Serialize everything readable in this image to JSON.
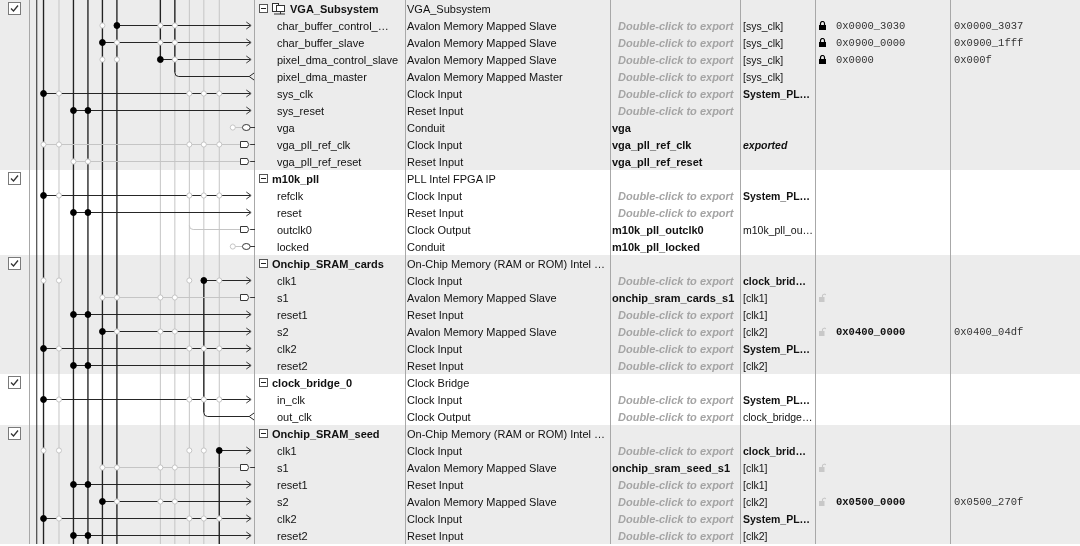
{
  "modules": [
    {
      "checked": true,
      "expanded": true,
      "kind": "subsystem",
      "name": "VGA_Subsystem",
      "description": "VGA_Subsystem",
      "ports": [
        {
          "name": "char_buffer_control_…",
          "description": "Avalon Memory Mapped Slave",
          "export": {
            "text": "Double-click to export",
            "kind": "hint"
          },
          "clock": {
            "text": "[sys_clk]",
            "kind": "domain"
          },
          "locked": true,
          "base": "0x0000_3030",
          "end": "0x0000_3037"
        },
        {
          "name": "char_buffer_slave",
          "description": "Avalon Memory Mapped Slave",
          "export": {
            "text": "Double-click to export",
            "kind": "hint"
          },
          "clock": {
            "text": "[sys_clk]",
            "kind": "domain"
          },
          "locked": true,
          "base": "0x0900_0000",
          "end": "0x0900_1fff"
        },
        {
          "name": "pixel_dma_control_slave",
          "description": "Avalon Memory Mapped Slave",
          "export": {
            "text": "Double-click to export",
            "kind": "hint"
          },
          "clock": {
            "text": "[sys_clk]",
            "kind": "domain"
          },
          "locked": true,
          "base": "0x0000",
          "end": "0x000f"
        },
        {
          "name": "pixel_dma_master",
          "description": "Avalon Memory Mapped Master",
          "export": {
            "text": "Double-click to export",
            "kind": "hint"
          },
          "clock": {
            "text": "[sys_clk]",
            "kind": "domain"
          }
        },
        {
          "name": "sys_clk",
          "description": "Clock Input",
          "export": {
            "text": "Double-click to export",
            "kind": "hint"
          },
          "clock": {
            "text": "System_PL…",
            "kind": "source"
          }
        },
        {
          "name": "sys_reset",
          "description": "Reset Input",
          "export": {
            "text": "Double-click to export",
            "kind": "hint"
          }
        },
        {
          "name": "vga",
          "description": "Conduit",
          "export": {
            "text": "vga",
            "kind": "name"
          }
        },
        {
          "name": "vga_pll_ref_clk",
          "description": "Clock Input",
          "export": {
            "text": "vga_pll_ref_clk",
            "kind": "name"
          },
          "clock": {
            "text": "exported",
            "kind": "exported"
          }
        },
        {
          "name": "vga_pll_ref_reset",
          "description": "Reset Input",
          "export": {
            "text": "vga_pll_ref_reset",
            "kind": "name"
          }
        }
      ]
    },
    {
      "checked": true,
      "expanded": true,
      "kind": "component",
      "name": "m10k_pll",
      "description": "PLL Intel FPGA IP",
      "ports": [
        {
          "name": "refclk",
          "description": "Clock Input",
          "export": {
            "text": "Double-click to export",
            "kind": "hint"
          },
          "clock": {
            "text": "System_PL…",
            "kind": "source"
          }
        },
        {
          "name": "reset",
          "description": "Reset Input",
          "export": {
            "text": "Double-click to export",
            "kind": "hint"
          }
        },
        {
          "name": "outclk0",
          "description": "Clock Output",
          "export": {
            "text": "m10k_pll_outclk0",
            "kind": "name"
          },
          "clock": {
            "text": "m10k_pll_ou…",
            "kind": "domain"
          }
        },
        {
          "name": "locked",
          "description": "Conduit",
          "export": {
            "text": "m10k_pll_locked",
            "kind": "name"
          }
        }
      ]
    },
    {
      "checked": true,
      "expanded": true,
      "kind": "component",
      "name": "Onchip_SRAM_cards",
      "description": "On-Chip Memory (RAM or ROM) Intel …",
      "ports": [
        {
          "name": "clk1",
          "description": "Clock Input",
          "export": {
            "text": "Double-click to export",
            "kind": "hint"
          },
          "clock": {
            "text": "clock_brid…",
            "kind": "source"
          }
        },
        {
          "name": "s1",
          "description": "Avalon Memory Mapped Slave",
          "export": {
            "text": "onchip_sram_cards_s1",
            "kind": "name"
          },
          "clock": {
            "text": "[clk1]",
            "kind": "domain"
          },
          "locked": false
        },
        {
          "name": "reset1",
          "description": "Reset Input",
          "export": {
            "text": "Double-click to export",
            "kind": "hint"
          },
          "clock": {
            "text": "[clk1]",
            "kind": "domain"
          }
        },
        {
          "name": "s2",
          "description": "Avalon Memory Mapped Slave",
          "export": {
            "text": "Double-click to export",
            "kind": "hint"
          },
          "clock": {
            "text": "[clk2]",
            "kind": "domain"
          },
          "locked": false,
          "base": "0x0400_0000",
          "end": "0x0400_04df"
        },
        {
          "name": "clk2",
          "description": "Clock Input",
          "export": {
            "text": "Double-click to export",
            "kind": "hint"
          },
          "clock": {
            "text": "System_PL…",
            "kind": "source"
          }
        },
        {
          "name": "reset2",
          "description": "Reset Input",
          "export": {
            "text": "Double-click to export",
            "kind": "hint"
          },
          "clock": {
            "text": "[clk2]",
            "kind": "domain"
          }
        }
      ]
    },
    {
      "checked": true,
      "expanded": true,
      "kind": "component",
      "name": "clock_bridge_0",
      "description": "Clock Bridge",
      "ports": [
        {
          "name": "in_clk",
          "description": "Clock Input",
          "export": {
            "text": "Double-click to export",
            "kind": "hint"
          },
          "clock": {
            "text": "System_PL…",
            "kind": "source"
          }
        },
        {
          "name": "out_clk",
          "description": "Clock Output",
          "export": {
            "text": "Double-click to export",
            "kind": "hint"
          },
          "clock": {
            "text": "clock_bridge…",
            "kind": "domain"
          }
        }
      ]
    },
    {
      "checked": true,
      "expanded": true,
      "kind": "component",
      "name": "Onchip_SRAM_seed",
      "description": "On-Chip Memory (RAM or ROM) Intel …",
      "ports": [
        {
          "name": "clk1",
          "description": "Clock Input",
          "export": {
            "text": "Double-click to export",
            "kind": "hint"
          },
          "clock": {
            "text": "clock_brid…",
            "kind": "source"
          }
        },
        {
          "name": "s1",
          "description": "Avalon Memory Mapped Slave",
          "export": {
            "text": "onchip_sram_seed_s1",
            "kind": "name"
          },
          "clock": {
            "text": "[clk1]",
            "kind": "domain"
          },
          "locked": false
        },
        {
          "name": "reset1",
          "description": "Reset Input",
          "export": {
            "text": "Double-click to export",
            "kind": "hint"
          },
          "clock": {
            "text": "[clk1]",
            "kind": "domain"
          }
        },
        {
          "name": "s2",
          "description": "Avalon Memory Mapped Slave",
          "export": {
            "text": "Double-click to export",
            "kind": "hint"
          },
          "clock": {
            "text": "[clk2]",
            "kind": "domain"
          },
          "locked": false,
          "base": "0x0500_0000",
          "end": "0x0500_270f"
        },
        {
          "name": "clk2",
          "description": "Clock Input",
          "export": {
            "text": "Double-click to export",
            "kind": "hint"
          },
          "clock": {
            "text": "System_PL…",
            "kind": "source"
          }
        },
        {
          "name": "reset2",
          "description": "Reset Input",
          "export": {
            "text": "Double-click to export",
            "kind": "hint"
          },
          "clock": {
            "text": "[clk2]",
            "kind": "domain"
          }
        }
      ]
    }
  ]
}
